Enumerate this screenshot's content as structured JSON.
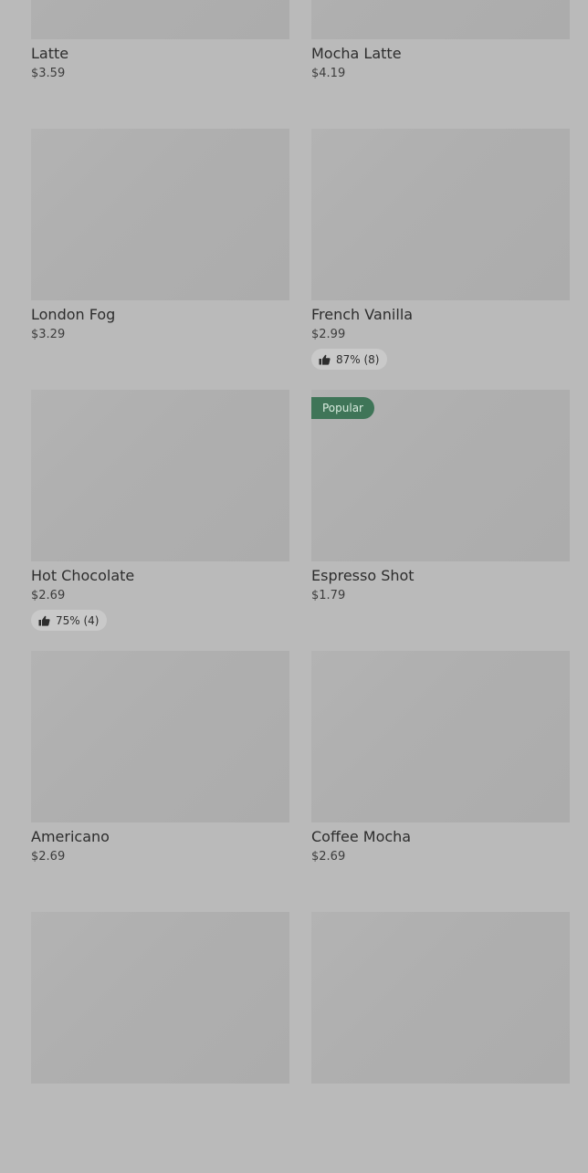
{
  "products": [
    {
      "name": "Latte",
      "price": "$3.59"
    },
    {
      "name": "Mocha Latte",
      "price": "$4.19"
    },
    {
      "name": "London Fog",
      "price": "$3.29"
    },
    {
      "name": "French Vanilla",
      "price": "$2.99",
      "rating": "87% (8)"
    },
    {
      "name": "Hot Chocolate",
      "price": "$2.69",
      "rating": "75% (4)"
    },
    {
      "name": "Espresso Shot",
      "price": "$1.79",
      "badge": "Popular"
    },
    {
      "name": "Americano",
      "price": "$2.69"
    },
    {
      "name": "Coffee Mocha",
      "price": "$2.69"
    },
    {
      "name": "",
      "price": ""
    },
    {
      "name": "",
      "price": ""
    }
  ],
  "colors": {
    "background": "#bababa",
    "image_placeholder": "#afafaf",
    "badge_bg": "#3f7558",
    "rating_pill_bg": "#c9c9c9"
  },
  "icons": {
    "rating": "thumbs-up-icon"
  }
}
